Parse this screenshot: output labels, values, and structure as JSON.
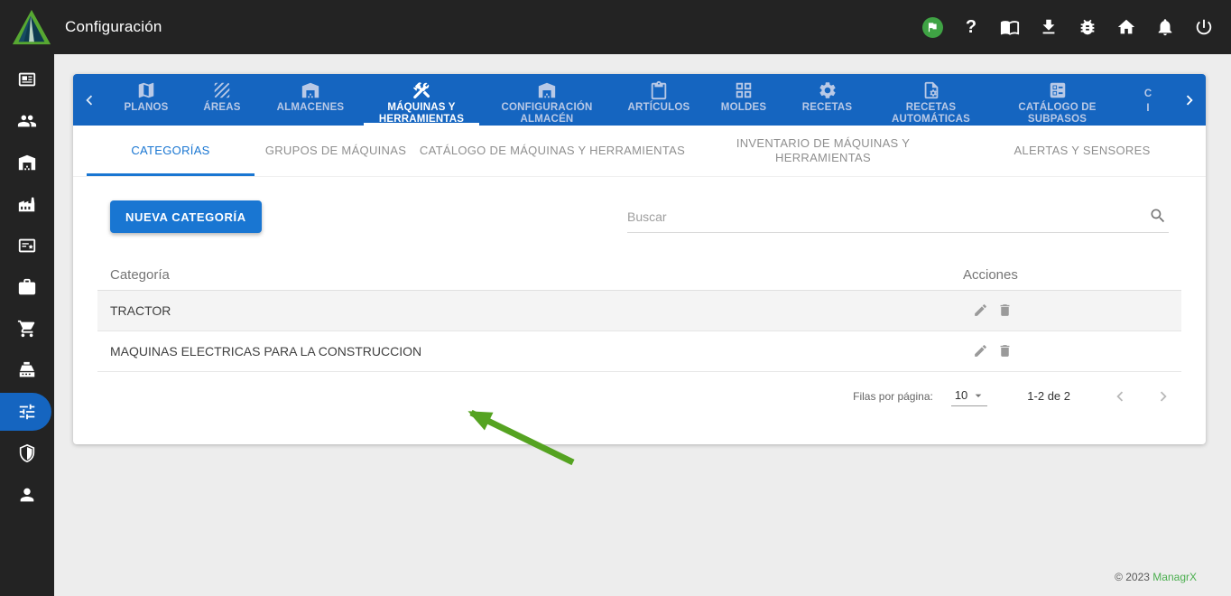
{
  "topbar": {
    "title": "Configuración",
    "icons": [
      "globe-icon",
      "help-icon",
      "book-icon",
      "download-icon",
      "bug-icon",
      "home-icon",
      "bell-icon",
      "power-icon"
    ]
  },
  "sidebar": {
    "icons": [
      "news-icon",
      "users-icon",
      "warehouse-icon",
      "factory-icon",
      "certificate-icon",
      "toolbox-icon",
      "cart-icon",
      "register-icon",
      "tune-icon",
      "shield-icon",
      "person-icon"
    ],
    "active_index": 8
  },
  "tabs": {
    "items": [
      {
        "label": "PLANOS",
        "icon": "map-icon",
        "active": false
      },
      {
        "label": "ÁREAS",
        "icon": "texture-icon",
        "active": false
      },
      {
        "label": "ALMACENES",
        "icon": "warehouse-icon",
        "active": false
      },
      {
        "label": "MÁQUINAS Y HERRAMIENTAS",
        "icon": "construction-icon",
        "active": true
      },
      {
        "label": "CONFIGURACIÓN ALMACÉN",
        "icon": "warehouse-icon",
        "active": false
      },
      {
        "label": "ARTÍCULOS",
        "icon": "clipboard-icon",
        "active": false
      },
      {
        "label": "MOLDES",
        "icon": "grid-icon",
        "active": false
      },
      {
        "label": "RECETAS",
        "icon": "gear-icon",
        "active": false
      },
      {
        "label": "RECETAS AUTOMÁTICAS",
        "icon": "file-gear-icon",
        "active": false
      },
      {
        "label": "CATÁLOGO DE SUBPASOS",
        "icon": "ballot-icon",
        "active": false
      }
    ],
    "truncated": {
      "line1": "C",
      "line2": "I"
    }
  },
  "subtabs": [
    {
      "label": "CATEGORÍAS",
      "active": true
    },
    {
      "label": "GRUPOS DE MÁQUINAS",
      "active": false
    },
    {
      "label": "CATÁLOGO DE MÁQUINAS Y HERRAMIENTAS",
      "active": false
    },
    {
      "label": "INVENTARIO DE MÁQUINAS Y HERRAMIENTAS",
      "active": false
    },
    {
      "label": "ALERTAS Y SENSORES",
      "active": false
    }
  ],
  "toolbar": {
    "new_button_label": "NUEVA CATEGORÍA",
    "search_placeholder": "Buscar"
  },
  "table": {
    "columns": [
      "Categoría",
      "Acciones"
    ],
    "rows": [
      {
        "name": "TRACTOR"
      },
      {
        "name": "MAQUINAS ELECTRICAS PARA LA CONSTRUCCION"
      }
    ],
    "row_actions": [
      "edit-icon",
      "delete-icon"
    ]
  },
  "pagination": {
    "rows_per_page_label": "Filas por página:",
    "rows_per_page": "10",
    "range": "1-2 de 2"
  },
  "footer": {
    "copyright": "© 2023",
    "brand": "ManagrX"
  },
  "colors": {
    "topbar_bg": "#232323",
    "tabbar_blue": "#1565c0",
    "accent_blue": "#1976d2",
    "arrow_green": "#55a321",
    "brand_green": "#4caf50",
    "globe_green": "#3fa344"
  }
}
